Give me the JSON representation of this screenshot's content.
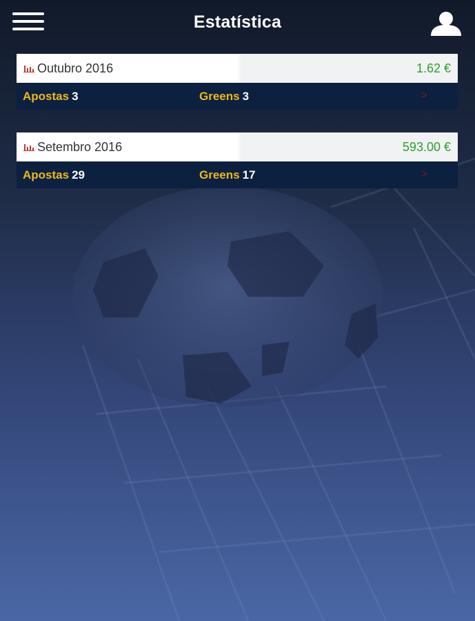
{
  "header": {
    "title": "Estatística"
  },
  "stats": [
    {
      "month": "Outubro 2016",
      "amount": "1.62 €",
      "apostas_label": "Apostas",
      "apostas_value": "3",
      "greens_label": "Greens",
      "greens_value": "3",
      "arrow": ">"
    },
    {
      "month": "Setembro 2016",
      "amount": "593.00 €",
      "apostas_label": "Apostas",
      "apostas_value": "29",
      "greens_label": "Greens",
      "greens_value": "17",
      "arrow": ">"
    }
  ],
  "colors": {
    "accent_yellow": "#f0b81a",
    "positive_green": "#2aa12a",
    "row_dark": "#0c2040",
    "icon_red": "#c0392b"
  },
  "icons": {
    "menu": "hamburger-menu-icon",
    "user": "user-icon",
    "chart": "bar-chart-icon",
    "arrow": "chevron-right-icon"
  }
}
